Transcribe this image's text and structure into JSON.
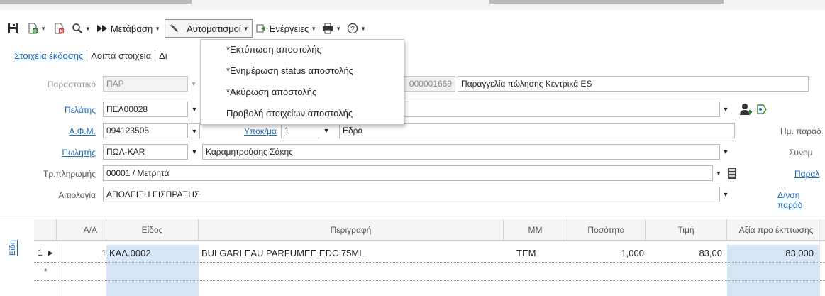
{
  "toolbar": {
    "goto_label": "Μετάβαση",
    "automation_label": "Αυτοματισμοί",
    "actions_label": "Ενέργειες"
  },
  "automation_menu": {
    "items": [
      "*Εκτύπωση αποστολής",
      "*Ενημέρωση status αποστολής",
      "*Ακύρωση αποστολής",
      "Προβολή στοιχείων αποστολής"
    ]
  },
  "tabs": [
    "Στοιχεία έκδοσης",
    "Λοιπά στοιχεία",
    "Δι"
  ],
  "form": {
    "doc_label": "Παραστατικό",
    "doc_value": "ΠΑΡ",
    "doc_number": "000001669",
    "doc_description": "Παραγγελία πώλησης Κεντρικά ES",
    "customer_label": "Πελάτης",
    "customer_value": "ΠΕΛ00028",
    "vat_label": "Α.Φ.Μ.",
    "vat_value": "094123505",
    "branch_label": "Υποκ/μα",
    "branch_value": "1",
    "branch_name": "Εδρα",
    "seller_label": "Πωλητής",
    "seller_value": "ΠΩΛ-KAR",
    "seller_name": "Καραμητρούσης Σάκης",
    "payment_label": "Τρ.πληρωμής",
    "payment_value": "00001 / Μετρητά",
    "reason_label": "Αιτιολογία",
    "reason_value": "ΑΠΟΔΕΙΞΗ ΕΙΣΠΡΑΞΗΣ",
    "right_labels": [
      "Ημ. παράδ",
      "Συνομ",
      "Παραλ",
      "Δ/νση παράδ"
    ]
  },
  "grid": {
    "side_tab": "Είδη",
    "columns": [
      "Α/Α",
      "Είδος",
      "Περιγραφή",
      "ΜΜ",
      "Ποσότητα",
      "Τιμή",
      "Αξία προ έκπτωσης"
    ],
    "rows": [
      {
        "row_num": "1",
        "aa": "1",
        "item": "ΚΑΛ.0002",
        "description": "BULGARI EAU PARFUMEE EDC 75ML",
        "unit": "ΤΕΜ",
        "quantity": "1,000",
        "price": "83,00",
        "value": "83,000"
      }
    ],
    "new_row_marker": "*"
  },
  "colors": {
    "accent": "#1a6bbf",
    "selected_cell": "#d6e6f6"
  }
}
